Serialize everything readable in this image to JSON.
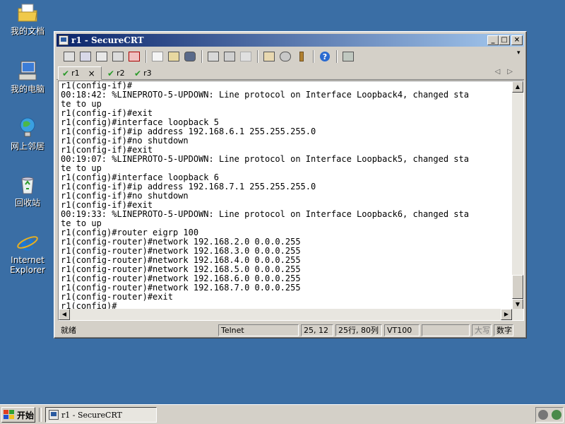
{
  "desktop": {
    "icons": [
      {
        "label": "我的文档"
      },
      {
        "label": "我的电脑"
      },
      {
        "label": "网上邻居"
      },
      {
        "label": "回收站"
      },
      {
        "label": "Internet Explorer"
      }
    ]
  },
  "window": {
    "title": "r1 - SecureCRT",
    "buttons": {
      "minimize": "_",
      "maximize": "□",
      "close": "×"
    }
  },
  "toolbar": {
    "icons": [
      "connect-icon",
      "quick-connect-icon",
      "connect-in-tab-icon",
      "reconnect-icon",
      "disconnect-icon",
      "copy-icon",
      "paste-icon",
      "find-icon",
      "print-icon",
      "print-selection-icon",
      "print-setup-icon",
      "session-options-icon",
      "global-options-icon",
      "keymap-icon",
      "help-icon",
      "sftp-icon"
    ]
  },
  "tabs": [
    {
      "label": "r1",
      "close": "×",
      "active": true
    },
    {
      "label": "r2",
      "active": false
    },
    {
      "label": "r3",
      "active": false
    }
  ],
  "terminal": {
    "lines": [
      "r1(config-if)#",
      "00:18:42: %LINEPROTO-5-UPDOWN: Line protocol on Interface Loopback4, changed sta",
      "te to up",
      "r1(config-if)#exit",
      "r1(config)#interface loopback 5",
      "r1(config-if)#ip address 192.168.6.1 255.255.255.0",
      "r1(config-if)#no shutdown",
      "r1(config-if)#exit",
      "00:19:07: %LINEPROTO-5-UPDOWN: Line protocol on Interface Loopback5, changed sta",
      "te to up",
      "r1(config)#interface loopback 6",
      "r1(config-if)#ip address 192.168.7.1 255.255.255.0",
      "r1(config-if)#no shutdown",
      "r1(config-if)#exit",
      "00:19:33: %LINEPROTO-5-UPDOWN: Line protocol on Interface Loopback6, changed sta",
      "te to up",
      "r1(config)#router eigrp 100",
      "r1(config-router)#network 192.168.2.0 0.0.0.255",
      "r1(config-router)#network 192.168.3.0 0.0.0.255",
      "r1(config-router)#network 192.168.4.0 0.0.0.255",
      "r1(config-router)#network 192.168.5.0 0.0.0.255",
      "r1(config-router)#network 192.168.6.0 0.0.0.255",
      "r1(config-router)#network 192.168.7.0 0.0.0.255",
      "r1(config-router)#exit",
      "r1(config)#"
    ]
  },
  "statusbar": {
    "ready": "就绪",
    "protocol": "Telnet",
    "cursor": "25, 12",
    "size": "25行, 80列",
    "emulation": "VT100",
    "caps": "大写",
    "num": "数字"
  },
  "taskbar": {
    "start": "开始",
    "task_title": "r1 - SecureCRT"
  },
  "colors": {
    "desktop": "#3a6ea5",
    "titlebar_start": "#0a246a",
    "titlebar_end": "#a6caf0"
  }
}
